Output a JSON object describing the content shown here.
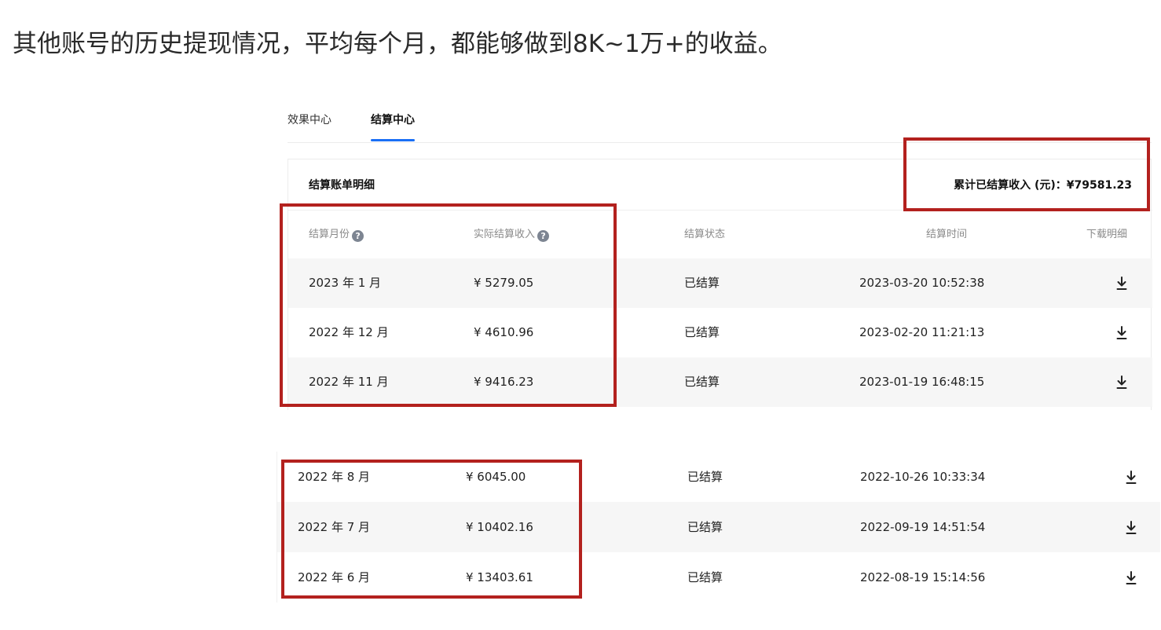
{
  "headline": "其他账号的历史提现情况，平均每个月，都能够做到8K~1万+的收益。",
  "tabs": [
    {
      "label": "效果中心",
      "active": false
    },
    {
      "label": "结算中心",
      "active": true
    }
  ],
  "card": {
    "title": "结算账单明细",
    "total_label": "累计已结算收入 (元)：¥79581.23"
  },
  "columns": {
    "month": "结算月份",
    "income": "实际结算收入",
    "status": "结算状态",
    "time": "结算时间",
    "download": "下载明细"
  },
  "rows_top": [
    {
      "month": "2023 年 1 月",
      "income": "¥ 5279.05",
      "status": "已结算",
      "time": "2023-03-20 10:52:38"
    },
    {
      "month": "2022 年 12 月",
      "income": "¥ 4610.96",
      "status": "已结算",
      "time": "2023-02-20 11:21:13"
    },
    {
      "month": "2022 年 11 月",
      "income": "¥ 9416.23",
      "status": "已结算",
      "time": "2023-01-19 16:48:15"
    }
  ],
  "rows_bottom": [
    {
      "month": "2022 年 8 月",
      "income": "¥ 6045.00",
      "status": "已结算",
      "time": "2022-10-26 10:33:34"
    },
    {
      "month": "2022 年 7 月",
      "income": "¥ 10402.16",
      "status": "已结算",
      "time": "2022-09-19 14:51:54"
    },
    {
      "month": "2022 年 6 月",
      "income": "¥ 13403.61",
      "status": "已结算",
      "time": "2022-08-19 15:14:56"
    }
  ],
  "icons": {
    "help": "question-circle-icon",
    "download": "download-icon"
  },
  "colors": {
    "accent": "#1a6ff5",
    "highlight": "#b3211e",
    "row_alt": "#f6f6f6"
  }
}
